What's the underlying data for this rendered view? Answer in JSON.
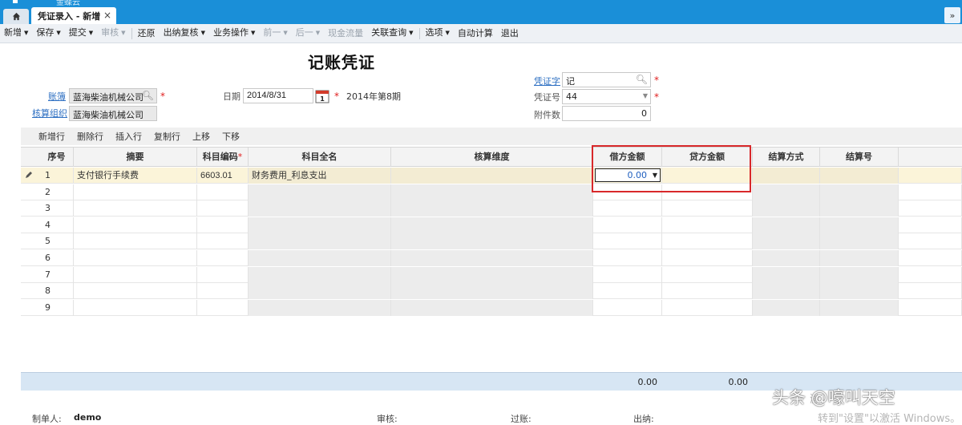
{
  "app": {
    "logo_text": "金蝶云"
  },
  "tabs": {
    "home_icon": "home-icon",
    "active_tab": "凭证录入 - 新增",
    "close": "×",
    "expand": "»"
  },
  "toolbar": {
    "items": [
      {
        "label": "新增",
        "arrow": "▼",
        "disabled": false
      },
      {
        "label": "保存",
        "arrow": "▼",
        "disabled": false
      },
      {
        "label": "提交",
        "arrow": "▼",
        "disabled": false
      },
      {
        "label": "审核",
        "arrow": "▼",
        "disabled": true
      },
      {
        "label": "还原",
        "arrow": "",
        "disabled": false
      },
      {
        "label": "出纳复核",
        "arrow": "▼",
        "disabled": false
      },
      {
        "label": "业务操作",
        "arrow": "▼",
        "disabled": false
      },
      {
        "label": "前一",
        "arrow": "▼",
        "disabled": true
      },
      {
        "label": "后一",
        "arrow": "▼",
        "disabled": true
      },
      {
        "label": "现金流量",
        "arrow": "",
        "disabled": true
      },
      {
        "label": "关联查询",
        "arrow": "▼",
        "disabled": false
      },
      {
        "label": "选项",
        "arrow": "▼",
        "disabled": false
      },
      {
        "label": "自动计算",
        "arrow": "",
        "disabled": false
      },
      {
        "label": "退出",
        "arrow": "",
        "disabled": false
      }
    ]
  },
  "form": {
    "title": "记账凭证",
    "ledger_label": "账簿",
    "ledger_value": "蓝海柴油机械公司",
    "org_label": "核算组织",
    "org_value": "蓝海柴油机械公司",
    "date_label": "日期",
    "date_value": "2014/8/31",
    "period_text": "2014年第8期",
    "voucher_word_label": "凭证字",
    "voucher_word_value": "记",
    "voucher_no_label": "凭证号",
    "voucher_no_value": "44",
    "attachments_label": "附件数",
    "attachments_value": "0",
    "required_mark": "*",
    "calendar_day": "1"
  },
  "row_actions": [
    "新增行",
    "删除行",
    "插入行",
    "复制行",
    "上移",
    "下移"
  ],
  "grid": {
    "columns": {
      "seq": "序号",
      "summary": "摘要",
      "account_code": "科目编码",
      "account_name": "科目全名",
      "dimension": "核算维度",
      "debit": "借方金额",
      "credit": "贷方金额",
      "settle_method": "结算方式",
      "settle_no": "结算号"
    },
    "rows": [
      {
        "seq": "1",
        "summary": "支付银行手续费",
        "account_code": "6603.01",
        "account_name": "财务费用_利息支出",
        "debit": "0.00"
      },
      {
        "seq": "2"
      },
      {
        "seq": "3"
      },
      {
        "seq": "4"
      },
      {
        "seq": "5"
      },
      {
        "seq": "6"
      },
      {
        "seq": "7"
      },
      {
        "seq": "8"
      },
      {
        "seq": "9"
      }
    ],
    "totals": {
      "debit": "0.00",
      "credit": "0.00"
    }
  },
  "footer": {
    "maker_label": "制单人:",
    "maker_value": "demo",
    "auditor_label": "审核:",
    "poster_label": "过账:",
    "cashier_label": "出纳:"
  },
  "watermark": {
    "line1": "头条 @嚎叫天空",
    "line2": "转到\"设置\"以激活 Windows。",
    "line3_prefix": "激"
  }
}
